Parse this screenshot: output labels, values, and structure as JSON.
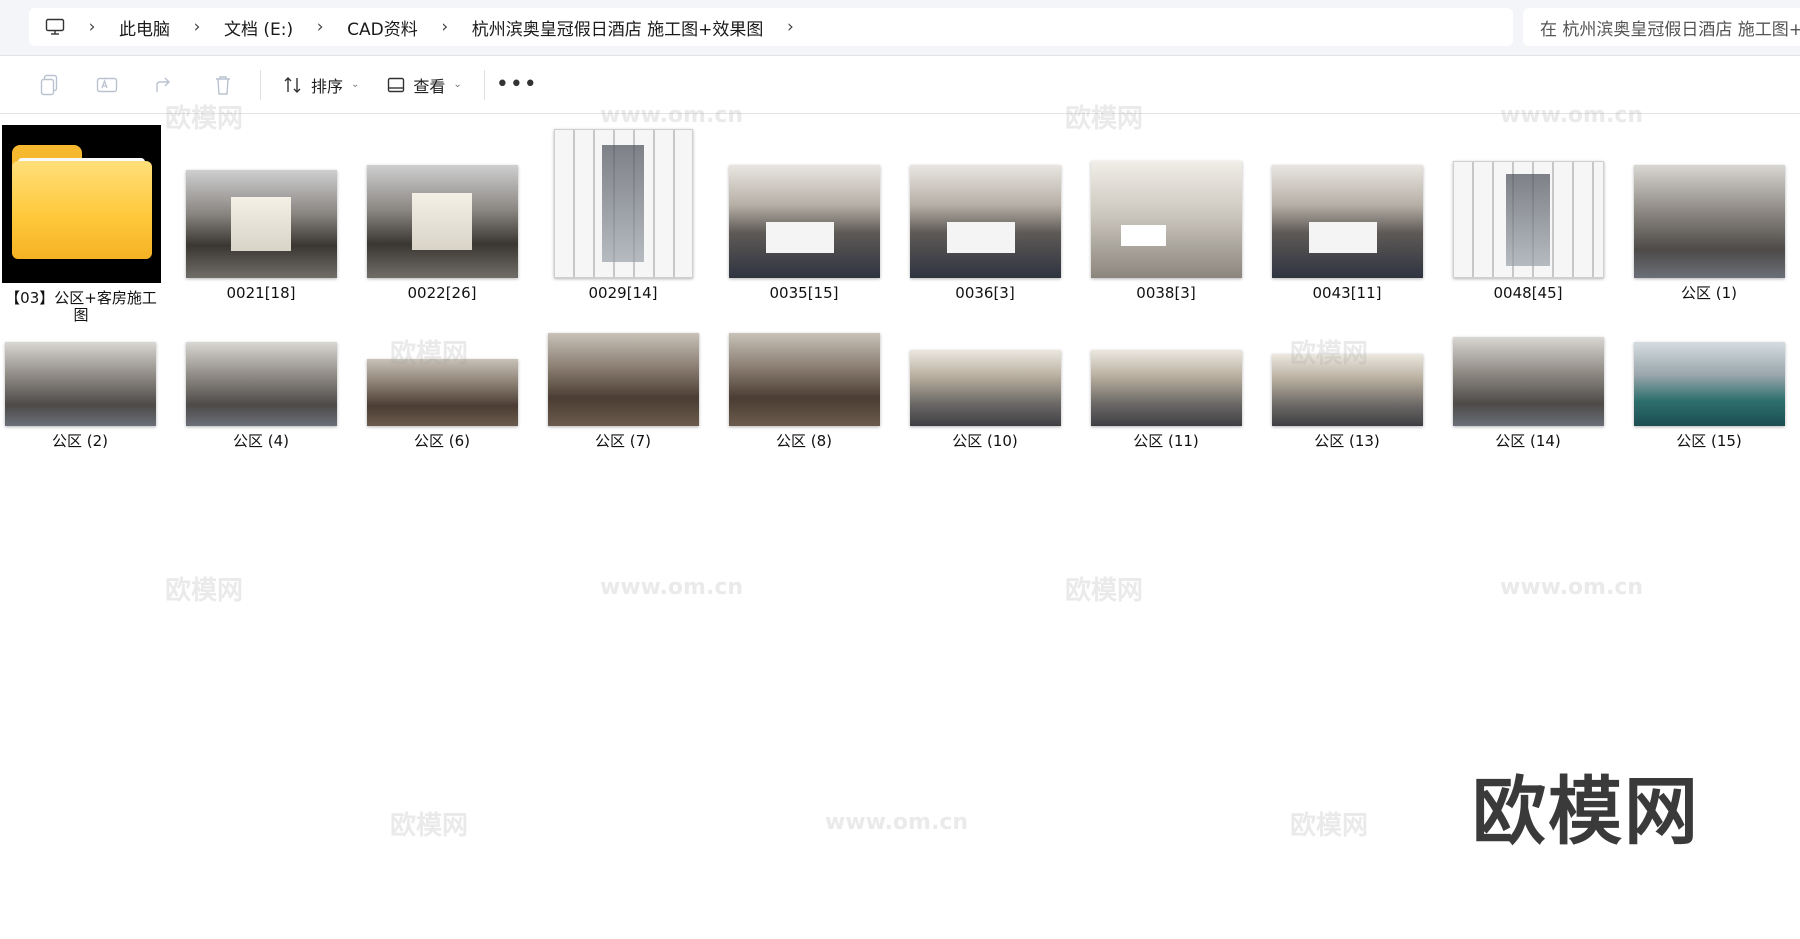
{
  "breadcrumb": {
    "items": [
      "此电脑",
      "文档 (E:)",
      "CAD资料",
      "杭州滨奥皇冠假日酒店 施工图+效果图"
    ]
  },
  "search": {
    "placeholder": "在 杭州滨奥皇冠假日酒店 施工图+效果图"
  },
  "toolbar": {
    "sort_label": "排序",
    "view_label": "查看",
    "more_label": "•••"
  },
  "items_row1": [
    {
      "name": "【03】公区+客房施工图",
      "kind": "folder"
    },
    {
      "name": "0021[18]",
      "kind": "corridor"
    },
    {
      "name": "0022[26]",
      "kind": "corridor"
    },
    {
      "name": "0029[14]",
      "kind": "plan"
    },
    {
      "name": "0035[15]",
      "kind": "room"
    },
    {
      "name": "0036[3]",
      "kind": "room"
    },
    {
      "name": "0038[3]",
      "kind": "bath"
    },
    {
      "name": "0043[11]",
      "kind": "room"
    },
    {
      "name": "0048[45]",
      "kind": "plan"
    },
    {
      "name": "公区 (1)",
      "kind": "lobby"
    }
  ],
  "items_row2": [
    {
      "name": "公区 (2)",
      "kind": "lobby"
    },
    {
      "name": "公区 (4)",
      "kind": "lobby"
    },
    {
      "name": "公区 (6)",
      "kind": "dining"
    },
    {
      "name": "公区 (7)",
      "kind": "dining"
    },
    {
      "name": "公区 (8)",
      "kind": "dining"
    },
    {
      "name": "公区 (10)",
      "kind": "hall"
    },
    {
      "name": "公区 (11)",
      "kind": "hall"
    },
    {
      "name": "公区 (13)",
      "kind": "hall"
    },
    {
      "name": "公区 (14)",
      "kind": "lobby"
    },
    {
      "name": "公区 (15)",
      "kind": "pool"
    }
  ],
  "watermark": {
    "logo_text": "欧模网",
    "url_text": "www.om.cn"
  }
}
